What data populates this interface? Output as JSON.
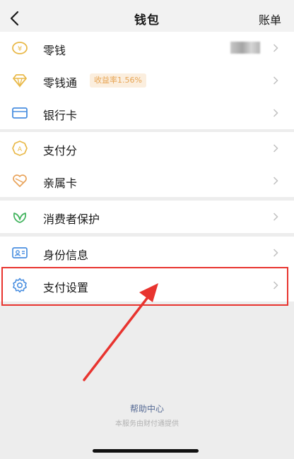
{
  "nav": {
    "title": "钱包",
    "right_label": "账单"
  },
  "groups": [
    {
      "items": [
        {
          "label": "零钱",
          "icon": "coin-icon"
        },
        {
          "label": "零钱通",
          "badge": "收益率1.56%",
          "icon": "diamond-icon"
        },
        {
          "label": "银行卡",
          "icon": "bank-card-icon"
        }
      ]
    },
    {
      "items": [
        {
          "label": "支付分",
          "icon": "pay-score-icon"
        },
        {
          "label": "亲属卡",
          "icon": "family-card-icon"
        }
      ]
    },
    {
      "items": [
        {
          "label": "消费者保护",
          "icon": "consumer-protection-icon"
        }
      ]
    },
    {
      "items": [
        {
          "label": "身份信息",
          "icon": "id-card-icon"
        },
        {
          "label": "支付设置",
          "icon": "settings-gear-icon"
        }
      ]
    }
  ],
  "footer": {
    "help": "帮助中心",
    "provider": "本服务由财付通提供"
  },
  "colors": {
    "icon_gold": "#e9b949",
    "icon_blue": "#4a8fe0",
    "icon_green": "#41b35d",
    "annotation_red": "#e8342f",
    "link_blue": "#576b95"
  }
}
